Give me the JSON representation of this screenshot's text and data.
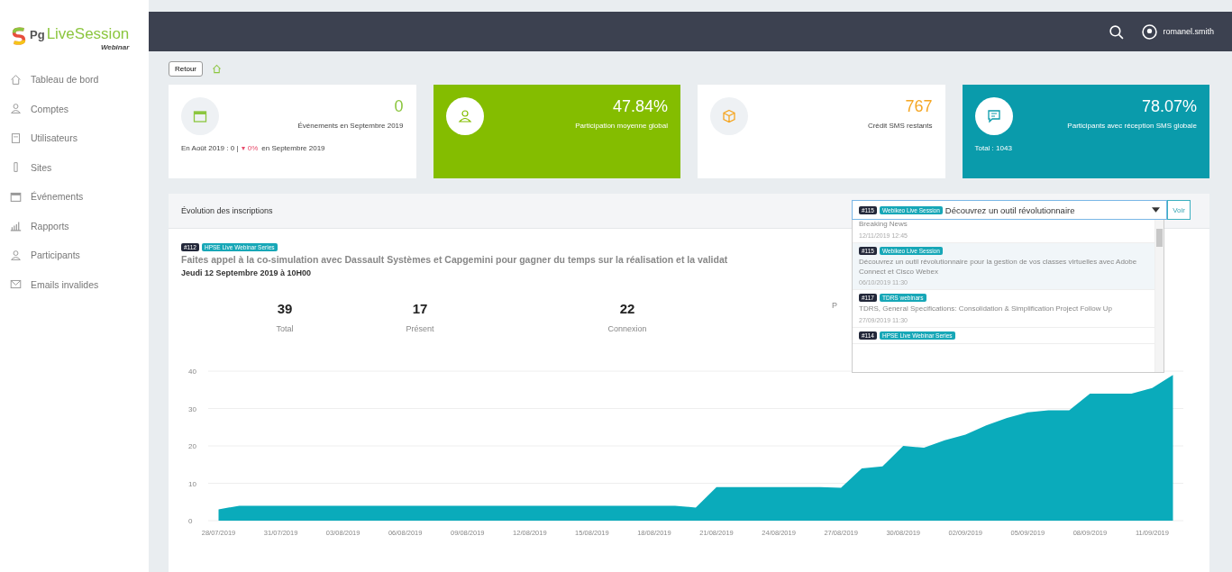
{
  "logo": {
    "name": "LiveSession",
    "mark": "Pg",
    "subtitle": "Webinar"
  },
  "sidebar": {
    "items": [
      {
        "label": "Tableau de bord"
      },
      {
        "label": "Comptes"
      },
      {
        "label": "Utilisateurs"
      },
      {
        "label": "Sites"
      },
      {
        "label": "Événements"
      },
      {
        "label": "Rapports"
      },
      {
        "label": "Participants"
      },
      {
        "label": "Emails invalides"
      }
    ]
  },
  "topbar": {
    "user": "romanel.smith"
  },
  "breadcrumb": {
    "back": "Retour"
  },
  "cards": [
    {
      "value": "0",
      "label": "Événements en Septembre 2019",
      "footer_prefix": "En Août 2019 : 0 |",
      "footer_change": "▾ 0%",
      "footer_suffix": "en Septembre 2019"
    },
    {
      "value": "47.84%",
      "label": "Participation moyenne global"
    },
    {
      "value": "767",
      "label": "Crédit SMS restants"
    },
    {
      "value": "78.07%",
      "label": "Participants avec réception SMS globale",
      "footer_prefix": "Total : 1043"
    }
  ],
  "panel": {
    "title": "Évolution des inscriptions",
    "select": {
      "number": "#115",
      "tag": "Webikeo Live Session",
      "title": "Découvrez un outil révolutionnaire",
      "button": "Voir"
    },
    "options": [
      {
        "title": "Breaking News",
        "date": "12/11/2019 12:45",
        "selected": false
      },
      {
        "number": "#115",
        "tag": "Webikeo Live Session",
        "title": "Découvrez un outil révolutionnaire pour la gestion de vos classes virtuelles avec Adobe Connect et Cisco Webex",
        "date": "06/10/2019 11:30",
        "selected": true
      },
      {
        "number": "#117",
        "tag": "TDRS webinars",
        "title": "TDRS, General Specifications: Consolidation & Simplification Project Follow Up",
        "date": "27/09/2019 11:30",
        "selected": false
      },
      {
        "number": "#114",
        "tag": "HPSE Live Webinar Series",
        "selected": false
      }
    ],
    "event": {
      "number": "#112",
      "tag": "HPSE Live Webinar Series",
      "title": "Faites appel à la co-simulation avec Dassault Systèmes et Capgemini pour gagner du temps sur la réalisation et la validat",
      "date": "Jeudi 12 Septembre 2019 à 10H00"
    },
    "stats": [
      {
        "value": "39",
        "label": "Total"
      },
      {
        "value": "17",
        "label": "Présent"
      },
      {
        "value": "22",
        "label": "Connexion"
      },
      {
        "label": "P"
      }
    ],
    "chart_data": {
      "type": "area",
      "categories": [
        "28/07/2019",
        null,
        null,
        "31/07/2019",
        null,
        null,
        "03/08/2019",
        null,
        null,
        "06/08/2019",
        null,
        null,
        "09/08/2019",
        null,
        null,
        "12/08/2019",
        null,
        null,
        "15/08/2019",
        null,
        null,
        "18/08/2019",
        null,
        null,
        "21/08/2019",
        null,
        null,
        "24/08/2019",
        null,
        null,
        "27/08/2019",
        null,
        null,
        "30/08/2019",
        null,
        null,
        "02/09/2019",
        null,
        null,
        "05/09/2019",
        null,
        null,
        "08/09/2019",
        null,
        null,
        "11/09/2019",
        null
      ],
      "series": [
        {
          "color": "#0aabbb",
          "values": [
            3,
            4,
            4,
            4,
            4,
            4,
            4,
            4,
            4,
            4,
            4,
            4,
            4,
            4,
            4,
            4,
            4,
            4,
            4,
            4,
            4,
            4,
            4,
            3.5,
            9,
            9,
            9,
            9,
            9,
            9,
            8.8,
            14,
            14.5,
            20,
            19.5,
            21.5,
            23,
            25.5,
            27.5,
            29,
            29.5,
            29.5,
            34,
            34,
            34,
            35.5,
            39
          ]
        }
      ],
      "ylim": [
        0,
        40
      ],
      "yticks": [
        0,
        10,
        20,
        30,
        40
      ],
      "grid": true
    }
  }
}
